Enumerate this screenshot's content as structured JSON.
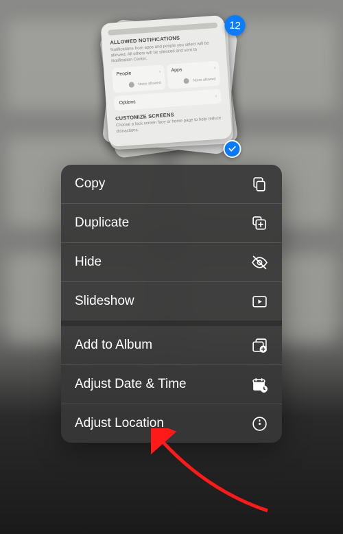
{
  "selection": {
    "count": "12",
    "preview": {
      "section1_title": "ALLOWED NOTIFICATIONS",
      "section1_desc": "Notifications from apps and people you select will be allowed. All others will be silenced and sent to Notification Center.",
      "box_people": "People",
      "box_apps": "Apps",
      "none_allowed": "None allowed",
      "options": "Options",
      "section2_title": "CUSTOMIZE SCREENS",
      "section2_desc": "Choose a lock screen face or home page to help reduce distractions."
    }
  },
  "menu": {
    "group1": [
      {
        "label": "Copy",
        "icon": "copy-icon"
      },
      {
        "label": "Duplicate",
        "icon": "duplicate-icon"
      },
      {
        "label": "Hide",
        "icon": "hide-icon"
      },
      {
        "label": "Slideshow",
        "icon": "slideshow-icon"
      }
    ],
    "group2": [
      {
        "label": "Add to Album",
        "icon": "add-album-icon"
      },
      {
        "label": "Adjust Date & Time",
        "icon": "calendar-icon"
      },
      {
        "label": "Adjust Location",
        "icon": "location-icon"
      }
    ]
  },
  "colors": {
    "accent": "#0a7cff",
    "annotation": "#ff1a1a",
    "menu_bg": "rgba(55,55,55,0.92)"
  }
}
